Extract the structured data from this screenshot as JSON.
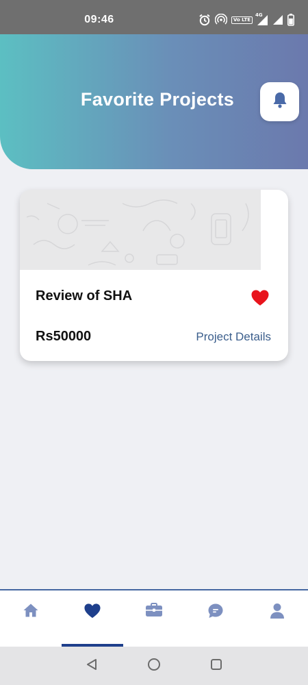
{
  "status_bar": {
    "time": "09:46",
    "volte_label": "Vo LTE",
    "network_label": "4G",
    "icons": [
      "alarm-icon",
      "hotspot-icon",
      "volte-icon",
      "signal-icon",
      "signal-icon",
      "battery-icon"
    ]
  },
  "header": {
    "title": "Favorite Projects",
    "notification_icon": "bell-icon"
  },
  "project_card": {
    "title": "Review of SHA",
    "price": "Rs50000",
    "details_label": "Project Details",
    "favorite_icon": "heart-icon",
    "favorite": true
  },
  "bottom_nav": {
    "items": [
      {
        "name": "home",
        "icon": "home-icon",
        "active": false
      },
      {
        "name": "favorites",
        "icon": "heart-icon",
        "active": true
      },
      {
        "name": "projects",
        "icon": "briefcase-icon",
        "active": false
      },
      {
        "name": "messages",
        "icon": "chat-icon",
        "active": false
      },
      {
        "name": "profile",
        "icon": "user-icon",
        "active": false
      }
    ]
  },
  "system_nav": {
    "icons": [
      "back-icon",
      "home-circle-icon",
      "recents-icon"
    ]
  },
  "colors": {
    "header_start": "#5cbfc2",
    "header_end": "#6b79ad",
    "accent": "#1e3f8c",
    "nav_inactive": "#7d90c0",
    "favorite": "#e8141c",
    "link": "#3b5e8c",
    "background": "#eff0f4"
  }
}
